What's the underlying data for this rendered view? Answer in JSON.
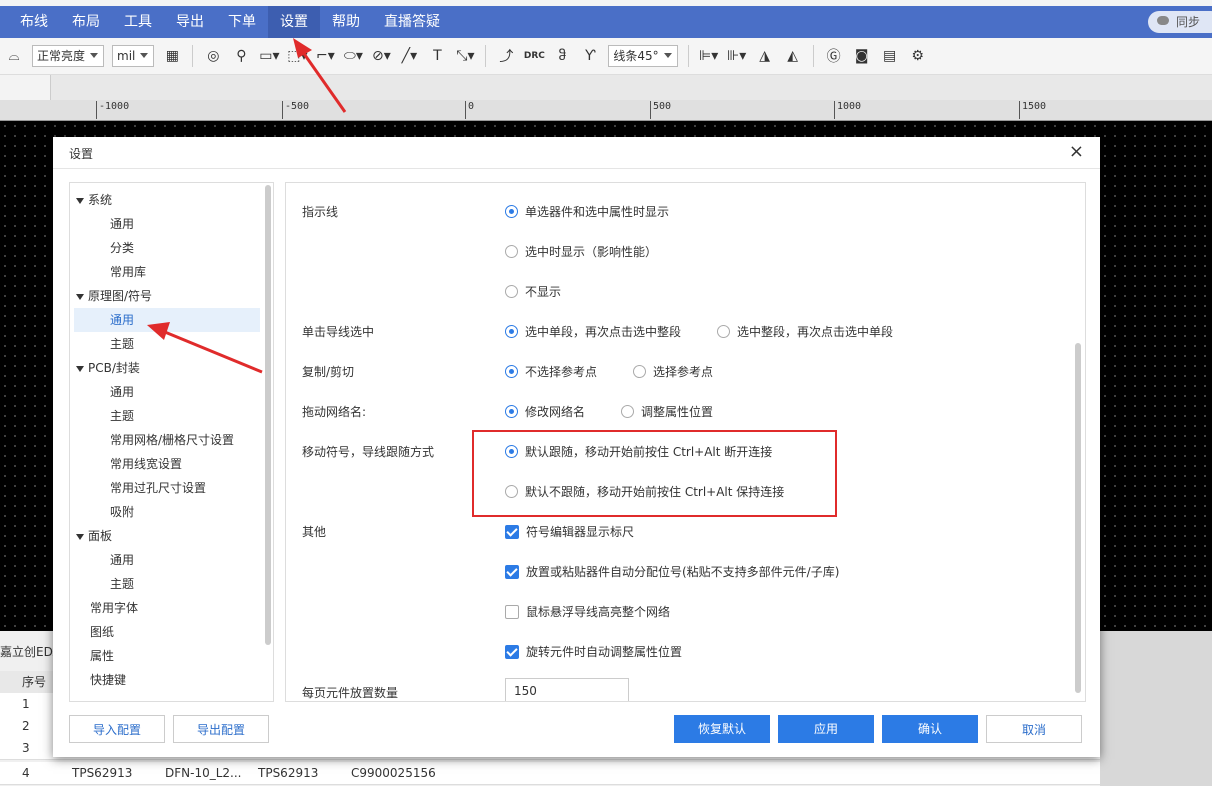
{
  "menubar": {
    "items": [
      "布线",
      "布局",
      "工具",
      "导出",
      "下单",
      "设置",
      "帮助",
      "直播答疑"
    ],
    "active_index": 5,
    "sync_label": "同步"
  },
  "toolbar": {
    "brightness": "正常亮度",
    "unit": "mil",
    "line_angle": "线条45°",
    "drc_label": "DRC",
    "text_tool_label": "T"
  },
  "ruler": {
    "labels": [
      "-1000",
      "-500",
      "0",
      "500",
      "1000",
      "1500"
    ]
  },
  "dialog": {
    "title": "设置",
    "close_icon": "×",
    "tree": [
      {
        "label": "系统",
        "level": 0,
        "expanded": true
      },
      {
        "label": "通用",
        "level": 1
      },
      {
        "label": "分类",
        "level": 1
      },
      {
        "label": "常用库",
        "level": 1
      },
      {
        "label": "原理图/符号",
        "level": 0,
        "expanded": true
      },
      {
        "label": "通用",
        "level": 1,
        "selected": true
      },
      {
        "label": "主题",
        "level": 1
      },
      {
        "label": "PCB/封装",
        "level": 0,
        "expanded": true
      },
      {
        "label": "通用",
        "level": 1
      },
      {
        "label": "主题",
        "level": 1
      },
      {
        "label": "常用网格/栅格尺寸设置",
        "level": 1
      },
      {
        "label": "常用线宽设置",
        "level": 1
      },
      {
        "label": "常用过孔尺寸设置",
        "level": 1
      },
      {
        "label": "吸附",
        "level": 1
      },
      {
        "label": "面板",
        "level": 0,
        "expanded": true
      },
      {
        "label": "通用",
        "level": 1
      },
      {
        "label": "主题",
        "level": 1
      },
      {
        "label": "常用字体",
        "level": 0,
        "leaf": true
      },
      {
        "label": "图纸",
        "level": 0,
        "leaf": true
      },
      {
        "label": "属性",
        "level": 0,
        "leaf": true
      },
      {
        "label": "快捷键",
        "level": 0,
        "leaf": true
      }
    ],
    "settings": {
      "indicator_line": {
        "label": "指示线",
        "options": [
          "单选器件和选中属性时显示",
          "选中时显示（影响性能）",
          "不显示"
        ],
        "selected": 0
      },
      "click_wire": {
        "label": "单击导线选中",
        "options": [
          "选中单段，再次点击选中整段",
          "选中整段，再次点击选中单段"
        ],
        "selected": 0
      },
      "copy_cut": {
        "label": "复制/剪切",
        "options": [
          "不选择参考点",
          "选择参考点"
        ],
        "selected": 0
      },
      "drag_net": {
        "label": "拖动网络名:",
        "options": [
          "修改网络名",
          "调整属性位置"
        ],
        "selected": 0
      },
      "move_symbol": {
        "label": "移动符号，导线跟随方式",
        "options": [
          "默认跟随，移动开始前按住 Ctrl+Alt 断开连接",
          "默认不跟随，移动开始前按住 Ctrl+Alt 保持连接"
        ],
        "selected": 0
      },
      "other": {
        "label": "其他",
        "checks": [
          {
            "label": "符号编辑器显示标尺",
            "checked": true
          },
          {
            "label": "放置或粘贴器件自动分配位号(粘贴不支持多部件元件/子库)",
            "checked": true
          },
          {
            "label": "鼠标悬浮导线高亮整个网络",
            "checked": false
          },
          {
            "label": "旋转元件时自动调整属性位置",
            "checked": true
          }
        ]
      },
      "per_page": {
        "label": "每页元件放置数量",
        "value": "150"
      }
    },
    "buttons": {
      "import": "导入配置",
      "export": "导出配置",
      "restore": "恢复默认",
      "apply": "应用",
      "confirm": "确认",
      "cancel": "取消"
    }
  },
  "bottom_panel": {
    "tab_label": "嘉立创EDA",
    "header_col": "序号",
    "rows": [
      {
        "index": "1",
        "cells": []
      },
      {
        "index": "2",
        "cells": []
      },
      {
        "index": "3",
        "cells": []
      },
      {
        "index": "4",
        "cells": [
          "TPS62913",
          "DFN-10_L2...",
          "TPS62913",
          "C9900025156"
        ]
      }
    ]
  },
  "colors": {
    "menubar": "#4a6fc7",
    "primary": "#2c7be5",
    "highlight": "#e02b2b"
  }
}
